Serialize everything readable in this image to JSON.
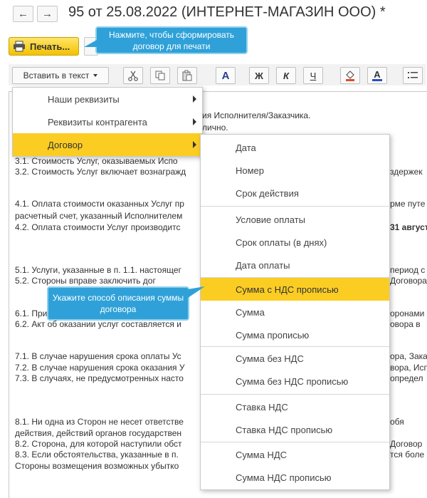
{
  "header": {
    "title": "95 от 25.08.2022 (ИНТЕРНЕТ-МАГАЗИН ООО) *",
    "back_icon": "←",
    "forward_icon": "→"
  },
  "print_button": {
    "label": "Печать..."
  },
  "callout_print": {
    "text": "Нажмите, чтобы сформировать договор для печати"
  },
  "callout_sum": {
    "text": "Укажите способ описания суммы договора"
  },
  "toolbar": {
    "insert_label": "Вставить в текст",
    "bold": "Ж",
    "italic": "К",
    "underline": "Ч",
    "font": "A",
    "font_color": "A"
  },
  "document": {
    "lines": [
      "ия Исполнителя/Заказчика.",
      " лично.",
      "3.1. Стоимость Услуг, оказываемых Испо",
      "3.2. Стоимость Услуг включает вознагражд",
      "4.1. Оплата стоимости оказанных Услуг пр",
      "расчетный счет, указанный Исполнителем",
      "4.2. Оплата стоимости Услуг производитс",
      "5.1. Услуги, указанные в п. 1.1. настоящег",
      "5.2. Стороны вправе заключить дог",
      "6.1. При",
      "6.2. Акт об оказании услуг составляется и",
      "7.1. В случае нарушения срока оплаты Ус",
      "7.2. В случае нарушения срока оказания У",
      "7.3. В случаях, не предусмотренных насто",
      "8.1. Ни одна из Сторон не несет ответстве",
      "действия, действий органов государствен",
      "8.2. Сторона, для которой наступили обст",
      "8.3. Если обстоятельства, указанные в п.",
      "Стороны возмещения возможных убытко"
    ],
    "right_fragments": [
      "здержек",
      "рме путе",
      "31 август",
      "период с",
      "Договора",
      "оронами",
      "овора в",
      "ора, Заказ",
      "вора, Исп",
      "определ",
      "обя",
      "Договор",
      "тся боле"
    ]
  },
  "menu1": {
    "items": [
      "Наши реквизиты",
      "Реквизиты контрагента",
      "Договор"
    ]
  },
  "menu2": {
    "groups": [
      [
        "Дата",
        "Номер",
        "Срок действия"
      ],
      [
        "Условие оплаты",
        "Срок оплаты (в днях)",
        "Дата оплаты"
      ],
      [
        "Сумма с НДС прописью",
        "Сумма",
        "Сумма прописью"
      ],
      [
        "Сумма без НДС",
        "Сумма без НДС прописью"
      ],
      [
        "Ставка НДС",
        "Ставка НДС прописью"
      ],
      [
        "Сумма НДС",
        "Сумма НДС прописью"
      ]
    ]
  },
  "colors": {
    "accent_yellow": "#fbcd23",
    "callout_blue": "#2fa1d8",
    "print_yellow": "#f7d23a"
  }
}
